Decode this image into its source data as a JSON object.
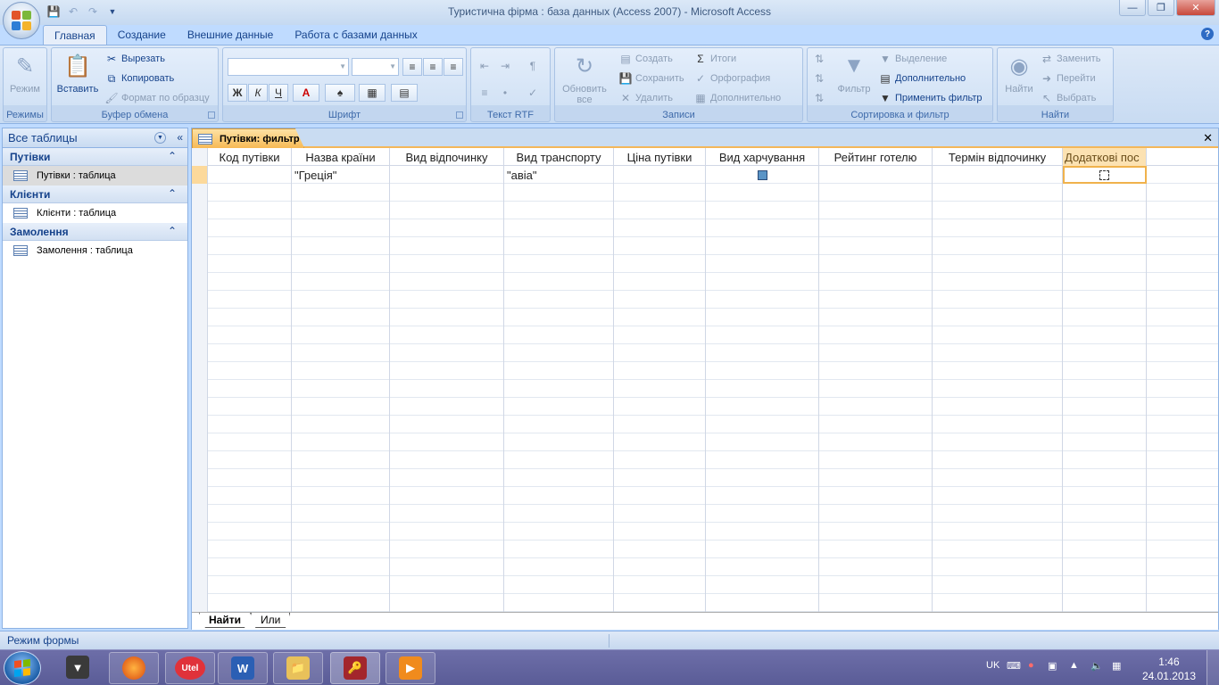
{
  "window": {
    "title": "Туристична фірма : база данных (Access 2007) - Microsoft Access"
  },
  "ribbon": {
    "tabs": [
      "Главная",
      "Создание",
      "Внешние данные",
      "Работа с базами данных"
    ],
    "groups": {
      "views": {
        "label": "Режимы",
        "mode": "Режим"
      },
      "clipboard": {
        "label": "Буфер обмена",
        "paste": "Вставить",
        "cut": "Вырезать",
        "copy": "Копировать",
        "format_painter": "Формат по образцу"
      },
      "font": {
        "label": "Шрифт",
        "bold": "Ж",
        "italic": "К",
        "underline": "Ч",
        "font_color": "A"
      },
      "rtf": {
        "label": "Текст RTF"
      },
      "records": {
        "label": "Записи",
        "refresh": "Обновить все",
        "new": "Создать",
        "save": "Сохранить",
        "delete": "Удалить",
        "totals": "Итоги",
        "spelling": "Орфография",
        "more": "Дополнительно"
      },
      "sort_filter": {
        "label": "Сортировка и фильтр",
        "filter": "Фильтр",
        "selection": "Выделение",
        "advanced": "Дополнительно",
        "apply_filter": "Применить фильтр"
      },
      "find": {
        "label": "Найти",
        "find": "Найти",
        "replace": "Заменить",
        "goto": "Перейти",
        "select": "Выбрать"
      }
    }
  },
  "nav": {
    "header": "Все таблицы",
    "groups": [
      {
        "title": "Путівки",
        "item": "Путівки : таблица"
      },
      {
        "title": "Клієнти",
        "item": "Клієнти : таблица"
      },
      {
        "title": "Замолення",
        "item": "Замолення : таблица"
      }
    ]
  },
  "document": {
    "tab_title": "Путівки: фильтр",
    "columns": [
      "Код путівки",
      "Назва країни",
      "Вид відпочинку",
      "Вид транспорту",
      "Ціна путівки",
      "Вид харчування",
      "Рейтинг готелю",
      "Термін відпочинку",
      "Додаткові пос"
    ],
    "criteria_row": {
      "country": "\"Греція\"",
      "transport": "\"авіа\""
    },
    "bottom_tabs": [
      "Найти",
      "Или"
    ]
  },
  "status": {
    "text": "Режим формы"
  },
  "taskbar": {
    "utel_label": "Utel",
    "lang": "UK",
    "time": "1:46",
    "date": "24.01.2013"
  },
  "colors": {
    "ribbon_bg": "#c8dbf2",
    "accent_tab": "#f7b955",
    "taskbar": "#5a5c97"
  }
}
